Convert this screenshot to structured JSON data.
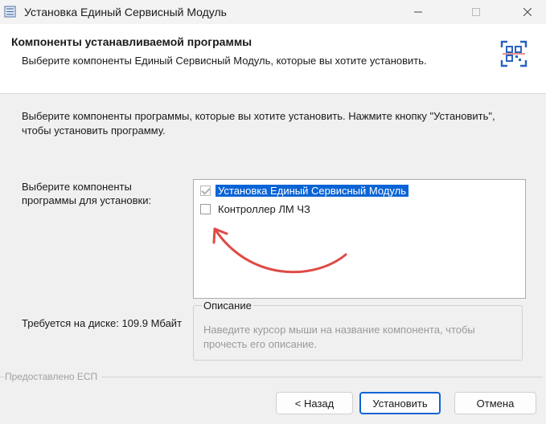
{
  "window": {
    "title": "Установка Единый Сервисный Модуль",
    "controls": [
      "minimize",
      "maximize",
      "close"
    ]
  },
  "header": {
    "title": "Компоненты устанавливаемой программы",
    "subtitle": "Выберите компоненты Единый Сервисный Модуль, которые вы хотите установить.",
    "logo_icon": "qr-logo-icon"
  },
  "body": {
    "intro": "Выберите компоненты программы, которые вы хотите установить. Нажмите кнопку \"Установить\", чтобы установить программу.",
    "select_label": "Выберите компоненты программы для установки:",
    "components": [
      {
        "label": "Установка Единый Сервисный Модуль",
        "checked": true,
        "selected": true,
        "disabled": true
      },
      {
        "label": "Контроллер ЛМ ЧЗ",
        "checked": false,
        "selected": false,
        "disabled": false
      }
    ],
    "description_title": "Описание",
    "description_text": "Наведите курсор мыши на название компонента, чтобы прочесть его описание.",
    "disk_space": "Требуется на диске: 109.9 Мбайт"
  },
  "footer": {
    "branding": "Предоставлено ЕСП",
    "back_label": "< Назад",
    "install_label": "Установить",
    "cancel_label": "Отмена"
  },
  "colors": {
    "accent": "#0a64d6",
    "annotation_arrow": "#e04a45"
  }
}
